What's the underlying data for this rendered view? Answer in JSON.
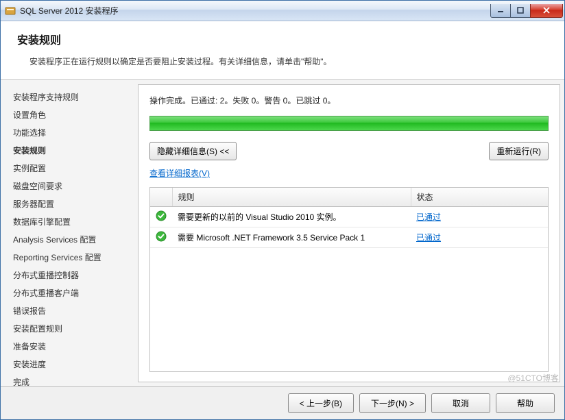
{
  "titlebar": {
    "title": "SQL Server 2012 安装程序"
  },
  "header": {
    "title": "安装规则",
    "subtitle": "安装程序正在运行规则以确定是否要阻止安装过程。有关详细信息，请单击\"帮助\"。"
  },
  "sidebar": {
    "items": [
      {
        "label": "安装程序支持规则",
        "active": false
      },
      {
        "label": "设置角色",
        "active": false
      },
      {
        "label": "功能选择",
        "active": false
      },
      {
        "label": "安装规则",
        "active": true
      },
      {
        "label": "实例配置",
        "active": false
      },
      {
        "label": "磁盘空间要求",
        "active": false
      },
      {
        "label": "服务器配置",
        "active": false
      },
      {
        "label": "数据库引擎配置",
        "active": false
      },
      {
        "label": "Analysis Services 配置",
        "active": false
      },
      {
        "label": "Reporting Services 配置",
        "active": false
      },
      {
        "label": "分布式重播控制器",
        "active": false
      },
      {
        "label": "分布式重播客户端",
        "active": false
      },
      {
        "label": "错误报告",
        "active": false
      },
      {
        "label": "安装配置规则",
        "active": false
      },
      {
        "label": "准备安装",
        "active": false
      },
      {
        "label": "安装进度",
        "active": false
      },
      {
        "label": "完成",
        "active": false
      }
    ]
  },
  "main": {
    "status_line": "操作完成。已通过: 2。失败 0。警告 0。已跳过 0。",
    "hide_details_btn": "隐藏详细信息(S) <<",
    "rerun_btn": "重新运行(R)",
    "report_link": "查看详细报表(V)",
    "columns": {
      "icon": "",
      "rule": "规则",
      "status": "状态"
    },
    "rows": [
      {
        "rule": "需要更新的以前的 Visual Studio 2010 实例。",
        "status": "已通过"
      },
      {
        "rule": "需要 Microsoft .NET Framework 3.5 Service Pack 1",
        "status": "已通过"
      }
    ]
  },
  "footer": {
    "back": "< 上一步(B)",
    "next": "下一步(N) >",
    "cancel": "取消",
    "help": "帮助"
  },
  "watermark": "@51CTO博客"
}
